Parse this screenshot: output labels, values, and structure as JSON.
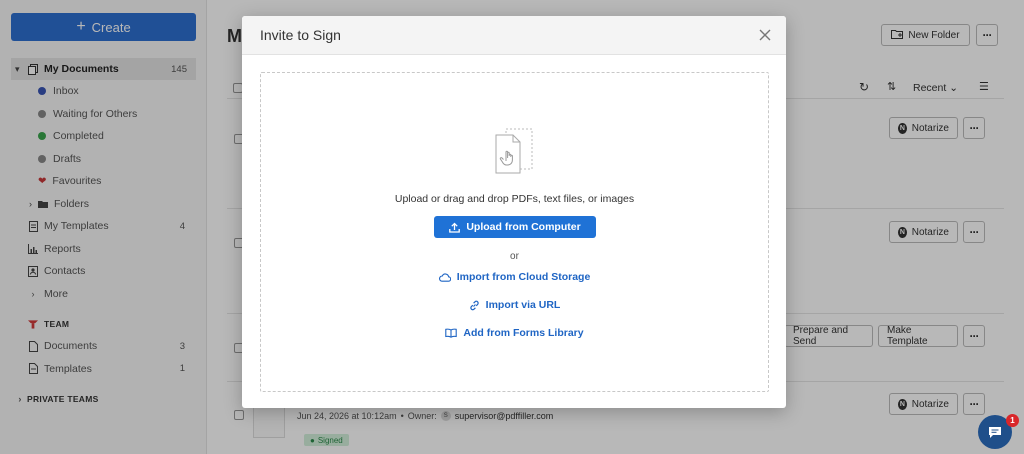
{
  "sidebar": {
    "create_label": "Create",
    "my_documents": {
      "label": "My Documents",
      "count": "145"
    },
    "items": [
      {
        "label": "Inbox",
        "color": "#3a55b5"
      },
      {
        "label": "Waiting for Others",
        "color": "#888888"
      },
      {
        "label": "Completed",
        "color": "#3aa54d"
      },
      {
        "label": "Drafts",
        "color": "#888888"
      },
      {
        "label": "Favourites",
        "color": "#c8383a"
      }
    ],
    "folders_label": "Folders",
    "my_templates": {
      "label": "My Templates",
      "count": "4"
    },
    "reports_label": "Reports",
    "contacts_label": "Contacts",
    "more_label": "More",
    "team_label": "TEAM",
    "team_documents": {
      "label": "Documents",
      "count": "3"
    },
    "team_templates": {
      "label": "Templates",
      "count": "1"
    },
    "private_teams_label": "PRIVATE TEAMS"
  },
  "main": {
    "title_initial": "M",
    "new_folder_label": "New Folder",
    "sort_label": "Recent",
    "notarize_label": "Notarize",
    "prepare_send_label": "Prepare and Send",
    "make_template_label": "Make Template",
    "last_row": {
      "date": "Jun 24, 2026 at 10:12am",
      "owner_label": "Owner:",
      "owner_initial": "S",
      "owner_email": "supervisor@pdffiller.com",
      "status": "Signed"
    }
  },
  "modal": {
    "title": "Invite to Sign",
    "drop_text": "Upload or drag and drop PDFs, text files, or images",
    "upload_label": "Upload from Computer",
    "or_label": "or",
    "cloud_label": "Import from Cloud Storage",
    "url_label": "Import via URL",
    "forms_label": "Add from Forms Library"
  },
  "chat": {
    "badge": "1"
  }
}
